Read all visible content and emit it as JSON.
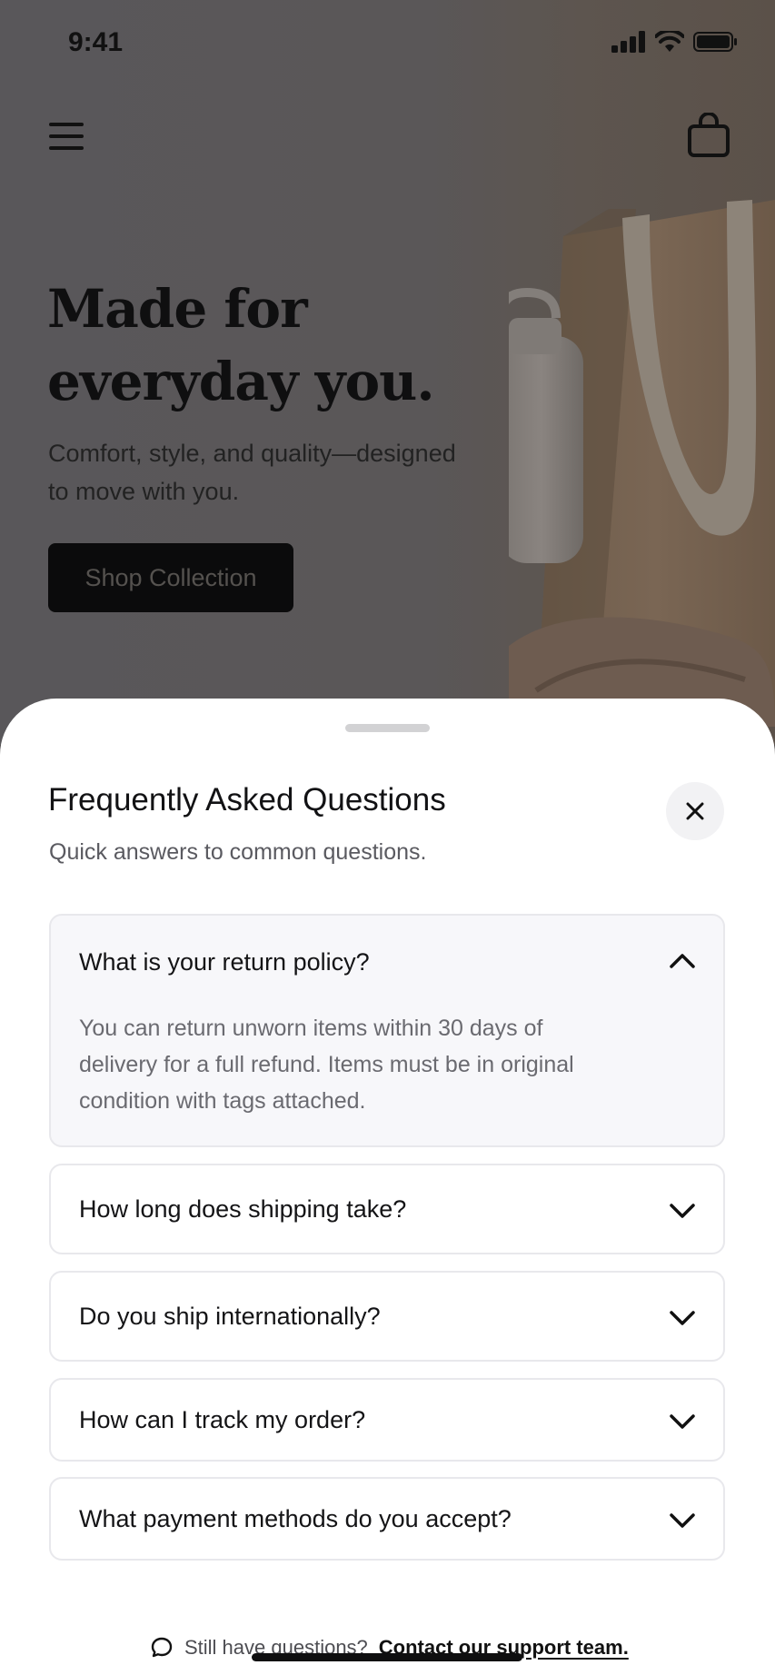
{
  "status_bar": {
    "time": "9:41"
  },
  "hero": {
    "title_line1": "Made for",
    "title_line2": "everyday you.",
    "subtitle_line1": "Comfort, style, and quality—designed",
    "subtitle_line2": "to move with you.",
    "cta_label": "Shop Collection"
  },
  "icons": {
    "menu": "menu-icon",
    "bag": "shopping-bag-icon",
    "close": "close-icon",
    "chat": "chat-bubble-icon",
    "chevron_up": "chevron-up-icon",
    "chevron_down": "chevron-down-icon"
  },
  "faq_sheet": {
    "title": "Frequently Asked Questions",
    "subtitle": "Quick answers to common questions.",
    "items": [
      {
        "question": "What is your return policy?",
        "expanded": true,
        "answer_line1": "You can return unworn items within 30 days of",
        "answer_line2": "delivery for a full refund. Items must be in original",
        "answer_line3": "condition with tags attached."
      },
      {
        "question": "How long does shipping take?",
        "expanded": false
      },
      {
        "question": "Do you ship internationally?",
        "expanded": false
      },
      {
        "question": "How can I track my order?",
        "expanded": false
      },
      {
        "question": "What payment methods do you accept?",
        "expanded": false
      }
    ],
    "footer_text": "Still have questions?",
    "footer_link": "Contact our support team."
  },
  "colors": {
    "overlay_bg": "#59575a",
    "sheet_bg": "#ffffff",
    "expanded_item_bg": "#f7f7fa",
    "cta_bg": "#0b0b0c"
  }
}
